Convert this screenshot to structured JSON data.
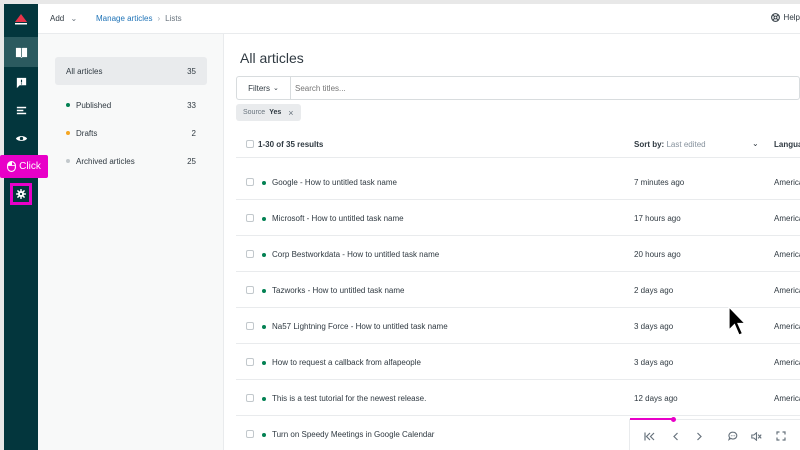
{
  "topbar": {
    "add_label": "Add",
    "breadcrumb": {
      "link": "Manage articles",
      "current": "Lists"
    },
    "help_label": "Help"
  },
  "side_filters": [
    {
      "label": "All articles",
      "count": "35",
      "active": true,
      "dot": ""
    },
    {
      "label": "Published",
      "count": "33",
      "active": false,
      "dot": "#038153"
    },
    {
      "label": "Drafts",
      "count": "2",
      "active": false,
      "dot": "#f5a623"
    },
    {
      "label": "Archived articles",
      "count": "25",
      "active": false,
      "dot": "#c2c8cc"
    }
  ],
  "main": {
    "title": "All articles",
    "filters_button": "Filters",
    "search_placeholder": "Search titles...",
    "chip": {
      "key": "Source",
      "value": "Yes"
    },
    "results_label": "1-30 of 35 results",
    "sort_label": "Sort by:",
    "sort_value": "Last edited",
    "language_header": "Langua"
  },
  "rows": [
    {
      "name": "Google - How to untitled task name",
      "edited": "7 minutes ago",
      "language": "America"
    },
    {
      "name": "Microsoft - How to untitled task name",
      "edited": "17 hours ago",
      "language": "America"
    },
    {
      "name": "Corp Bestworkdata - How to untitled task name",
      "edited": "20 hours ago",
      "language": "America"
    },
    {
      "name": "Tazworks - How to untitled task name",
      "edited": "2 days ago",
      "language": "America"
    },
    {
      "name": "Na57 Lightning Force - How to untitled task name",
      "edited": "3 days ago",
      "language": "America"
    },
    {
      "name": "How to request a callback from alfapeople",
      "edited": "3 days ago",
      "language": "America"
    },
    {
      "name": "This is a test tutorial for the newest release.",
      "edited": "12 days ago",
      "language": "America"
    },
    {
      "name": "Turn on Speedy Meetings in Google Calendar",
      "edited": "",
      "language": ""
    }
  ],
  "overlay": {
    "click_label": "Click"
  },
  "player": {
    "progress": 0.25
  },
  "colors": {
    "rail": "#03363d",
    "accent": "#e800c8",
    "published": "#038153",
    "draft": "#f5a623",
    "link": "#1f73b7"
  },
  "icons": [
    "logo-icon",
    "book-icon",
    "feedback-icon",
    "list-icon",
    "eye-icon",
    "gear-icon",
    "help-icon",
    "mouse-icon",
    "cursor-icon",
    "skip-back-icon",
    "prev-icon",
    "next-icon",
    "caption-icon",
    "mute-icon",
    "fullscreen-icon"
  ]
}
